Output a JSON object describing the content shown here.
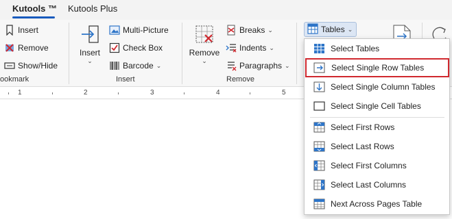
{
  "tabs": [
    {
      "label": "Kutools ™",
      "active": true
    },
    {
      "label": "Kutools Plus",
      "active": false
    }
  ],
  "ribbon": {
    "bookmark_group": {
      "label": "ookmark",
      "items": [
        "Insert",
        "Remove",
        "Show/Hide"
      ]
    },
    "insert_group": {
      "label": "Insert",
      "big_button": "Insert",
      "items": [
        "Multi-Picture",
        "Check Box",
        "Barcode"
      ]
    },
    "remove_group": {
      "label": "Remove",
      "big_button": "Remove",
      "items": [
        "Breaks",
        "Indents",
        "Paragraphs"
      ]
    },
    "tables_button": "Tables"
  },
  "ruler": {
    "numbers": [
      "1",
      "2",
      "3",
      "4",
      "5"
    ]
  },
  "tables_menu": {
    "items": [
      {
        "label": "Select Tables",
        "icon": "grid-table-icon",
        "highlighted": false
      },
      {
        "label": "Select Single Row Tables",
        "icon": "single-row-icon",
        "highlighted": true
      },
      {
        "label": "Select Single Column Tables",
        "icon": "single-column-icon",
        "highlighted": false
      },
      {
        "label": "Select Single Cell Tables",
        "icon": "single-cell-icon",
        "highlighted": false
      },
      {
        "label": "Select First Rows",
        "icon": "first-rows-icon",
        "highlighted": false
      },
      {
        "label": "Select Last Rows",
        "icon": "last-rows-icon",
        "highlighted": false
      },
      {
        "label": "Select First Columns",
        "icon": "first-columns-icon",
        "highlighted": false
      },
      {
        "label": "Select Last Columns",
        "icon": "last-columns-icon",
        "highlighted": false
      },
      {
        "label": "Next Across Pages Table",
        "icon": "next-table-icon",
        "highlighted": false
      }
    ]
  },
  "colors": {
    "accent": "#185abd",
    "highlight_border": "#d0282e",
    "table_icon_blue": "#2e75c8"
  }
}
